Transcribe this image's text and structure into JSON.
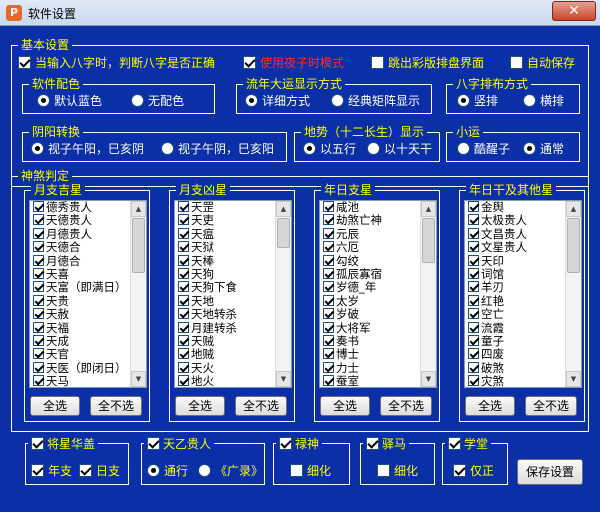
{
  "window": {
    "title": "软件设置",
    "close_label": "✕",
    "app_icon": "P"
  },
  "basic": {
    "legend": "基本设置",
    "opt1": "当输入八字时，判断八字是否正确",
    "opt2": "使用夜子时模式",
    "opt3": "跳出彩版排盘界面",
    "opt4": "自动保存"
  },
  "color_scheme": {
    "legend": "软件配色",
    "opt1": "默认蓝色",
    "opt2": "无配色"
  },
  "luck_display": {
    "legend": "流年大运显示方式",
    "opt1": "详细方式",
    "opt2": "经典矩阵显示"
  },
  "layout": {
    "legend": "八字排布方式",
    "opt1": "竖排",
    "opt2": "横排"
  },
  "calendar": {
    "legend": "阴阳转换",
    "opt1": "视子午阳，巳亥阴",
    "opt2": "视子午阴，巳亥阳"
  },
  "terrain": {
    "legend": "地势（十二长生）显示",
    "opt1": "以五行",
    "opt2": "以十天干"
  },
  "small_luck": {
    "legend": "小运",
    "opt1": "酷醒子",
    "opt2": "通常"
  },
  "shensha": {
    "legend": "神煞判定",
    "lists": [
      {
        "label": "月支吉星",
        "items": [
          "德秀贵人",
          "天德贵人",
          "月德贵人",
          "天德合",
          "月德合",
          "天喜",
          "天富（即满日）",
          "天贵",
          "天赦",
          "天福",
          "天成",
          "天官",
          "天医（即闭日）",
          "天马"
        ]
      },
      {
        "label": "月支凶星",
        "items": [
          "天罡",
          "天吏",
          "天瘟",
          "天狱",
          "天棒",
          "天狗",
          "天狗下食",
          "天地",
          "天地转杀",
          "月建转杀",
          "天贼",
          "地贼",
          "天火",
          "地火"
        ]
      },
      {
        "label": "年日支星",
        "items": [
          "咸池",
          "劫煞亡神",
          "元辰",
          "六厄",
          "勾绞",
          "孤辰寡宿",
          "岁德_年",
          "太岁",
          "岁破",
          "大将军",
          "奏书",
          "博士",
          "力士",
          "蚕室"
        ]
      },
      {
        "label": "年日干及其他星",
        "items": [
          "金舆",
          "太极贵人",
          "文昌贵人",
          "文星贵人",
          "天印",
          "词馆",
          "羊刃",
          "红艳",
          "空亡",
          "流霞",
          "童子",
          "四废",
          "破煞",
          "灾煞"
        ]
      }
    ],
    "select_all": "全选",
    "select_none": "全不选"
  },
  "bottom": {
    "jiang_xing": {
      "label": "将星华盖",
      "opt1": "年支",
      "opt2": "日支"
    },
    "tian_yi": {
      "label": "天乙贵人",
      "opt1": "通行",
      "opt2": "《广录》"
    },
    "lu_shen": {
      "label": "禄神",
      "opt1": "细化"
    },
    "yi_ma": {
      "label": "驿马",
      "opt1": "细化"
    },
    "xue_tang": {
      "label": "学堂",
      "opt1": "仅正"
    },
    "save": "保存设置"
  },
  "colors": {
    "bg": "#0a2fa6",
    "label": "#ffff00",
    "highlight": "#ff2a2a"
  }
}
